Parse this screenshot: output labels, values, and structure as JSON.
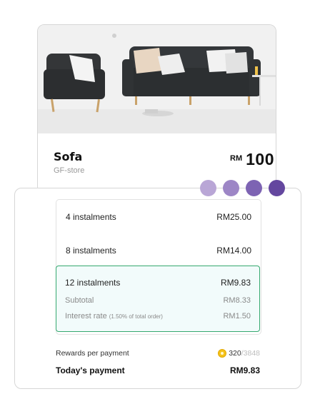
{
  "product": {
    "name": "Sofa",
    "store": "GF-store",
    "currency": "RM",
    "price": "100"
  },
  "progress_dots": {
    "colors": [
      "#b9a6d6",
      "#9d86c6",
      "#7d63b3",
      "#64479f"
    ]
  },
  "instalments": [
    {
      "label": "4 instalments",
      "amount": "RM25.00"
    },
    {
      "label": "8 instalments",
      "amount": "RM14.00"
    }
  ],
  "selected": {
    "label": "12 instalments",
    "amount": "RM9.83",
    "subtotal_label": "Subtotal",
    "subtotal_amount": "RM8.33",
    "interest_label": "Interest rate",
    "interest_note": "(1.50% of total order)",
    "interest_amount": "RM1.50"
  },
  "rewards": {
    "label": "Rewards per payment",
    "points": "320",
    "total": "/3848"
  },
  "today": {
    "label": "Today's payment",
    "amount": "RM9.83"
  },
  "colors": {
    "selected_border": "#35a96f",
    "selected_bg": "#f2fbfb",
    "coin": "#f4c21c"
  }
}
